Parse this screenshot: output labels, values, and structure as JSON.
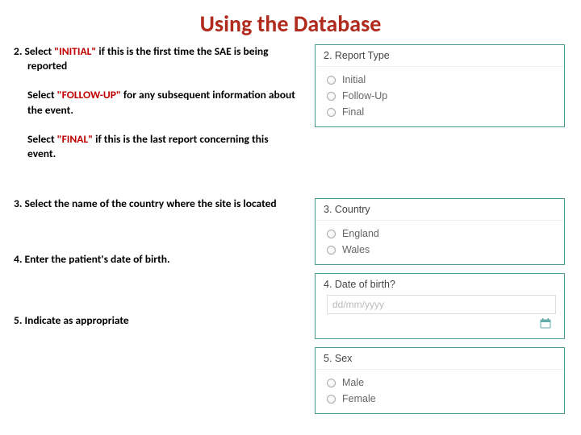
{
  "title": "Using the Database",
  "left": {
    "item2_num": "2. ",
    "item2_a1": "Select ",
    "item2_a2": "\"INITIAL\"",
    "item2_a3": " if this is the first time the SAE is being reported",
    "item2_b1": "Select ",
    "item2_b2": "\"FOLLOW-UP\"",
    "item2_b3": " for any subsequent information about the event.",
    "item2_c1": "Select ",
    "item2_c2": "\"FINAL\"",
    "item2_c3": " if this is the last report concerning this event.",
    "item3": "3. Select the name of the country where the site is located",
    "item4": "4. Enter the patient's date of birth.",
    "item5": "5. Indicate as appropriate"
  },
  "panels": {
    "p2": {
      "header": "2. Report Type",
      "opt1": "Initial",
      "opt2": "Follow-Up",
      "opt3": "Final"
    },
    "p3": {
      "header": "3. Country",
      "opt1": "England",
      "opt2": "Wales"
    },
    "p4": {
      "header": "4. Date of birth?",
      "placeholder": "dd/mm/yyyy"
    },
    "p5": {
      "header": "5. Sex",
      "opt1": "Male",
      "opt2": "Female"
    }
  }
}
